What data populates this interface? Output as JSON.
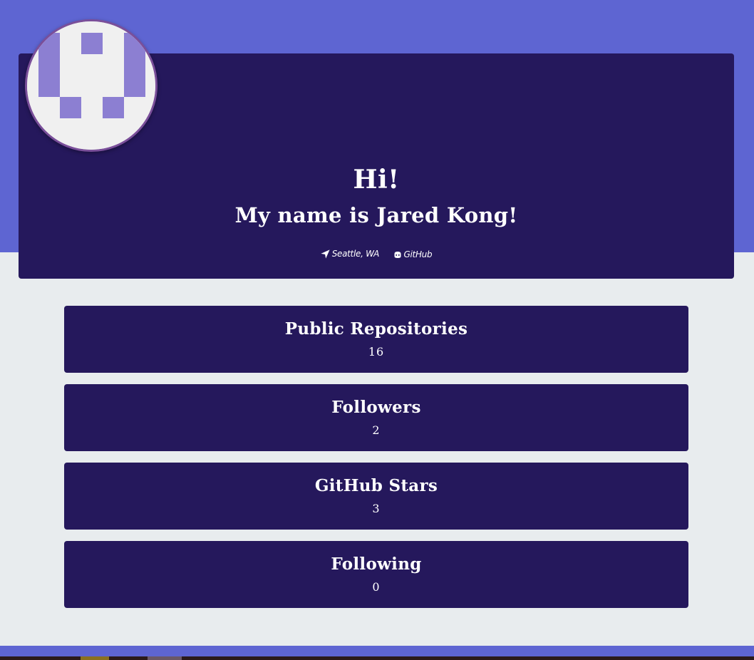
{
  "hero": {
    "greeting": "Hi!",
    "name_line": "My name is Jared Kong!",
    "location": "Seattle, WA",
    "github_link": "GitHub",
    "location_icon": "location-arrow-icon",
    "github_icon": "github-icon"
  },
  "stats": [
    {
      "title": "Public Repositories",
      "value": "16"
    },
    {
      "title": "Followers",
      "value": "2"
    },
    {
      "title": "GitHub Stars",
      "value": "3"
    },
    {
      "title": "Following",
      "value": "0"
    }
  ],
  "colors": {
    "top_band": "#5e65d2",
    "card_bg": "#25185c",
    "page_bg": "#e8ecee",
    "avatar_tile": "#8c7fd2",
    "avatar_border": "#7a4f9a"
  }
}
